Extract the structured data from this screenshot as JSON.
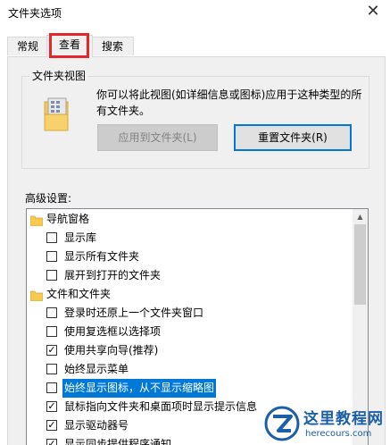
{
  "window": {
    "title": "文件夹选项",
    "close_glyph": "✕"
  },
  "tabs": [
    {
      "label": "常规"
    },
    {
      "label": "查看"
    },
    {
      "label": "搜索"
    }
  ],
  "folder_views": {
    "group_label": "文件夹视图",
    "description": "你可以将此视图(如详细信息或图标)应用于这种类型的所有文件夹。",
    "apply_button": "应用到文件夹(L)",
    "reset_button": "重置文件夹(R)"
  },
  "advanced": {
    "label": "高级设置:",
    "items": [
      {
        "type": "folder",
        "label": "导航窗格"
      },
      {
        "type": "checkbox",
        "label": "显示库",
        "checked": false
      },
      {
        "type": "checkbox",
        "label": "显示所有文件夹",
        "checked": false
      },
      {
        "type": "checkbox",
        "label": "展开到打开的文件夹",
        "checked": false
      },
      {
        "type": "folder",
        "label": "文件和文件夹"
      },
      {
        "type": "checkbox",
        "label": "登录时还原上一个文件夹窗口",
        "checked": false
      },
      {
        "type": "checkbox",
        "label": "使用复选框以选择项",
        "checked": false
      },
      {
        "type": "checkbox",
        "label": "使用共享向导(推荐)",
        "checked": true
      },
      {
        "type": "checkbox",
        "label": "始终显示菜单",
        "checked": false
      },
      {
        "type": "checkbox",
        "label": "始终显示图标，从不显示缩略图",
        "checked": false,
        "selected": true
      },
      {
        "type": "checkbox",
        "label": "鼠标指向文件夹和桌面项时显示提示信息",
        "checked": true
      },
      {
        "type": "checkbox",
        "label": "显示驱动器号",
        "checked": true
      },
      {
        "type": "checkbox",
        "label": "显示同步提供程序通知",
        "checked": true
      }
    ]
  },
  "watermark": {
    "site_name": "这里教程网",
    "domain": "herecours.com"
  },
  "colors": {
    "accent": "#0078d7",
    "highlight_box": "#e5262a",
    "watermark": "#1b5fa8"
  }
}
